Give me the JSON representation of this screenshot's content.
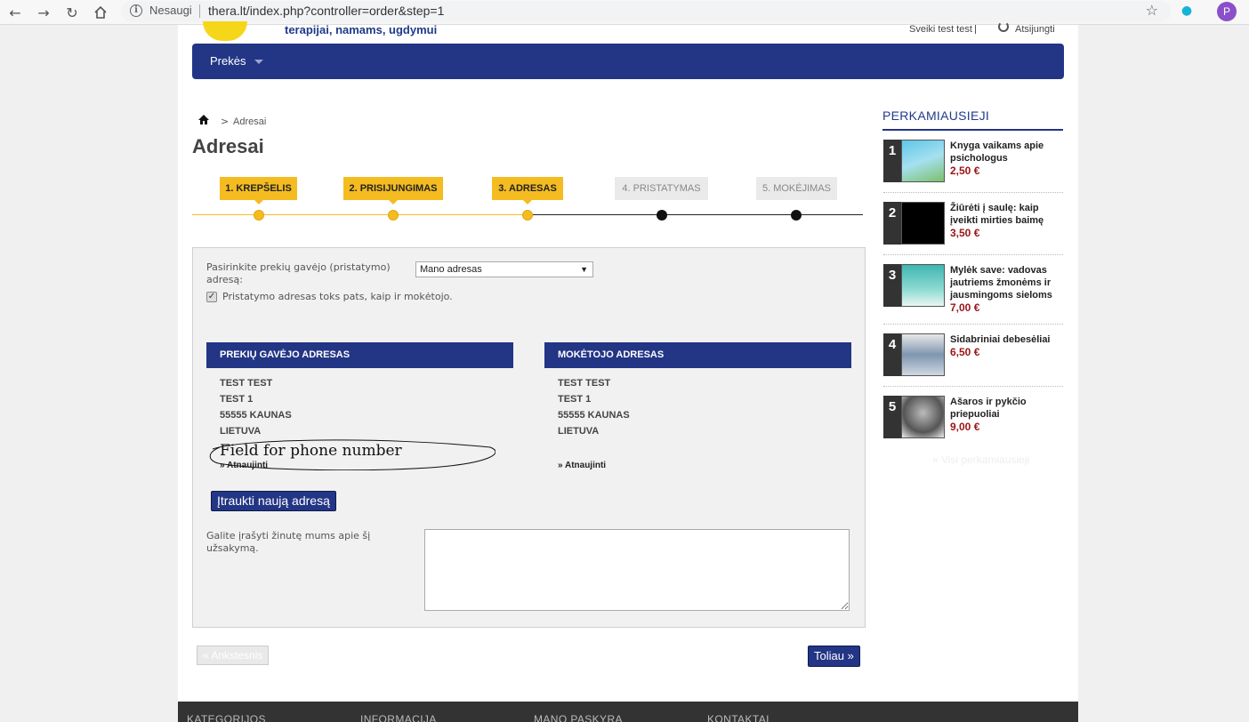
{
  "browser": {
    "insecure_label": "Nesaugi",
    "url": "thera.lt/index.php?controller=order&step=1",
    "profile_initial": "P"
  },
  "header": {
    "tagline": "terapijai, namams, ugdymui",
    "greeting": "Sveiki test test",
    "logout": "Atsijungti"
  },
  "nav": {
    "prekes": "Prekės"
  },
  "breadcrumb": {
    "separator": ">",
    "current": "Adresai"
  },
  "page_title": "Adresai",
  "steps": [
    {
      "label": "1. KREPŠELIS",
      "state": "done"
    },
    {
      "label": "2. PRISIJUNGIMAS",
      "state": "done"
    },
    {
      "label": "3. ADRESAS",
      "state": "done"
    },
    {
      "label": "4. PRISTATYMAS",
      "state": "todo"
    },
    {
      "label": "5. MOKĖJIMAS",
      "state": "todo"
    }
  ],
  "form": {
    "recipient_label": "Pasirinkite prekių gavėjo (pristatymo) adresą:",
    "address_select_value": "Mano adresas",
    "same_address_label": "Pristatymo adresas toks pats, kaip ir mokėtojo.",
    "same_address_checked": true,
    "delivery_heading": "PREKIŲ GAVĖJO ADRESAS",
    "billing_heading": "MOKĖTOJO ADRESAS",
    "delivery_lines": [
      "TEST TEST",
      "TEST 1",
      "55555 KAUNAS",
      "LIETUVA"
    ],
    "billing_lines": [
      "TEST TEST",
      "TEST 1",
      "55555 KAUNAS",
      "LIETUVA"
    ],
    "phone_annotation": "Field for phone number",
    "update_link": "» Atnaujinti",
    "add_address_button": "Įtraukti naują adresą",
    "message_label": "Galite įrašyti žinutę mums apie šį užsakymą.",
    "message_value": ""
  },
  "buttons": {
    "previous": "« Ankstesnis",
    "next": "Toliau »"
  },
  "sidebar": {
    "title": "PERKAMIAUSIEJI",
    "items": [
      {
        "rank": "1",
        "name": "Knyga vaikams apie psichologus",
        "price": "2,50 €"
      },
      {
        "rank": "2",
        "name": "Žiūrėti į saulę: kaip įveikti mirties baimę",
        "price": "3,50 €"
      },
      {
        "rank": "3",
        "name": "Mylėk save: vadovas jautriems žmonėms ir jausmingoms sieloms",
        "price": "7,00 €"
      },
      {
        "rank": "4",
        "name": "Sidabriniai debesėliai",
        "price": "6,50 €"
      },
      {
        "rank": "5",
        "name": "Ašaros ir pykčio priepuoliai",
        "price": "9,00 €"
      }
    ],
    "all_link": "» Visi perkamiausieji"
  },
  "footer": {
    "cols": [
      "KATEGORIJOS",
      "INFORMACIJA",
      "MANO PASKYRA",
      "KONTAKTAI"
    ]
  },
  "colors": {
    "navy": "#233585",
    "yellow": "#f5bc21",
    "price_red": "#9b1518"
  }
}
